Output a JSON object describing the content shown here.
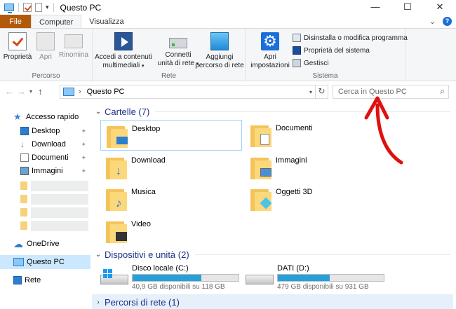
{
  "window": {
    "title": "Questo PC",
    "controls": {
      "minimize": "—",
      "maximize": "☐",
      "close": "✕"
    }
  },
  "tabs": [
    {
      "label": "File"
    },
    {
      "label": "Computer"
    },
    {
      "label": "Visualizza"
    }
  ],
  "ribbon": {
    "groups": {
      "percorso": {
        "label": "Percorso",
        "buttons": [
          {
            "label": "Proprietà",
            "icon": "properties-icon"
          },
          {
            "label": "Apri",
            "icon": "open-icon"
          },
          {
            "label": "Rinomina",
            "icon": "rename-icon"
          }
        ]
      },
      "rete": {
        "label": "Rete",
        "buttons": [
          {
            "line1": "Accedi a contenuti",
            "line2": "multimediali",
            "icon": "media-icon"
          },
          {
            "line1": "Connetti",
            "line2": "unità di rete",
            "icon": "network-drive-icon"
          },
          {
            "line1": "Aggiungi",
            "line2": "percorso di rete",
            "icon": "network-location-icon"
          }
        ]
      },
      "sistema": {
        "label": "Sistema",
        "open_settings": {
          "line1": "Apri",
          "line2": "impostazioni"
        },
        "small": [
          {
            "label": "Disinstalla o modifica programma"
          },
          {
            "label": "Proprietà del sistema"
          },
          {
            "label": "Gestisci"
          }
        ]
      }
    }
  },
  "address": {
    "path": "Questo PC",
    "search_placeholder": "Cerca in Questo PC"
  },
  "nav": {
    "quick_access": "Accesso rapido",
    "pinned": [
      {
        "label": "Desktop",
        "icon": "desktop-icon"
      },
      {
        "label": "Download",
        "icon": "download-icon"
      },
      {
        "label": "Documenti",
        "icon": "documents-icon"
      },
      {
        "label": "Immagini",
        "icon": "pictures-icon"
      }
    ],
    "onedrive": "OneDrive",
    "this_pc": "Questo PC",
    "network": "Rete"
  },
  "content": {
    "folders_header": "Cartelle (7)",
    "folders": [
      {
        "label": "Desktop"
      },
      {
        "label": "Documenti"
      },
      {
        "label": "Download"
      },
      {
        "label": "Immagini"
      },
      {
        "label": "Musica"
      },
      {
        "label": "Oggetti 3D"
      },
      {
        "label": "Video"
      }
    ],
    "devices_header": "Dispositivi e unità (2)",
    "drives": [
      {
        "name": "Disco locale (C:)",
        "info": "40,9 GB disponibili su 118 GB",
        "used_fraction": 0.65
      },
      {
        "name": "DATI (D:)",
        "info": "479 GB disponibili su 931 GB",
        "used_fraction": 0.49
      }
    ],
    "network_header": "Percorsi di rete (1)"
  },
  "colors": {
    "file_tab": "#b25a0a",
    "selection": "#cce8ff",
    "section_header": "#1e3287",
    "drive_bar": "#26a0da",
    "annotation": "#e01010"
  }
}
